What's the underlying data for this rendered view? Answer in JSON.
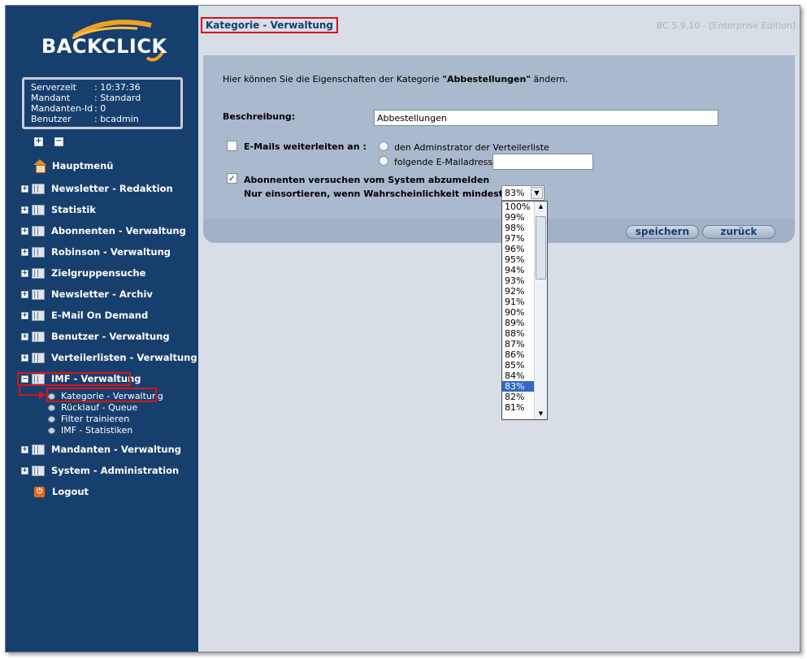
{
  "app": {
    "logo_text": "BACKCLICK",
    "version": "BC 5.9.10 - [Enterprise Edition]"
  },
  "server_info": {
    "rows": [
      {
        "key": "Serverzeit",
        "value": ": 10:37:36"
      },
      {
        "key": "Mandant",
        "value": ": Standard"
      },
      {
        "key": "Mandanten-Id",
        "value": ": 0"
      },
      {
        "key": "Benutzer",
        "value": ": bcadmin"
      }
    ]
  },
  "expand_controls": {
    "expand_all": "+",
    "collapse_all": "−"
  },
  "nav": {
    "home": "Hauptmenü",
    "items": [
      "Newsletter - Redaktion",
      "Statistik",
      "Abonnenten - Verwaltung",
      "Robinson - Verwaltung",
      "Zielgruppensuche",
      "Newsletter - Archiv",
      "E-Mail On Demand",
      "Benutzer - Verwaltung",
      "Verteilerlisten - Verwaltung"
    ],
    "imf": {
      "label": "IMF - Verwaltung",
      "children": [
        "Kategorie - Verwaltung",
        "Rücklauf - Queue",
        "Filter trainieren",
        "IMF - Statistiken"
      ]
    },
    "after": [
      "Mandanten - Verwaltung",
      "System - Administration"
    ],
    "logout": "Logout"
  },
  "page": {
    "title": "Kategorie - Verwaltung",
    "intro_prefix": "Hier können Sie die Eigenschaften der Kategorie ",
    "intro_category": "\"Abbestellungen\"",
    "intro_suffix": " ändern."
  },
  "form": {
    "description_label": "Beschreibung:",
    "description_value": "Abbestellungen",
    "forward_label": "E-Mails weiterleiten an :",
    "forward_checked": false,
    "radio_admin": "den Adminstrator der Verteilerliste",
    "radio_email": "folgende E-Mailadresse :",
    "email_value": "",
    "unsubscribe_label": "Abonnenten versuchen vom System abzumelden",
    "unsubscribe_checked": true,
    "probability_label": "Nur einsortieren, wenn Wahrscheinlichkeit mindestens:",
    "probability_value": "83%",
    "probability_options": [
      "100%",
      "99%",
      "98%",
      "97%",
      "96%",
      "95%",
      "94%",
      "93%",
      "92%",
      "91%",
      "90%",
      "89%",
      "88%",
      "87%",
      "86%",
      "85%",
      "84%",
      "83%",
      "82%",
      "81%"
    ],
    "probability_selected_index": 17
  },
  "buttons": {
    "save": "speichern",
    "back": "zurück"
  },
  "colors": {
    "sidebar": "#173f6e",
    "highlight": "#d4151c",
    "panel": "#aab9cd",
    "selection": "#3169c6"
  }
}
